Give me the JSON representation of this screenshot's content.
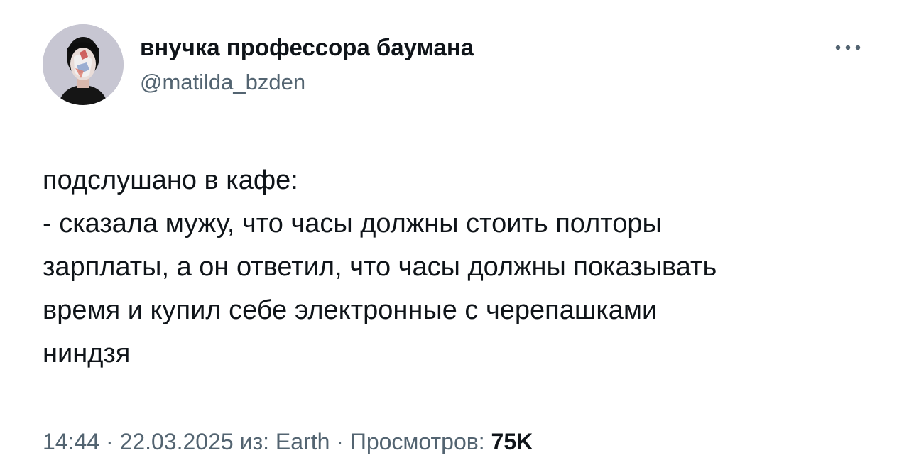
{
  "author": {
    "display_name": "внучка профессора баумана",
    "handle": "@matilda_bzden",
    "avatar": "avatar"
  },
  "more_icon": "more-horizontal-icon",
  "tweet": {
    "lines": [
      "подслушано в кафе:",
      "- сказала мужу, что часы должны стоить полторы",
      "зарплаты, а он ответил, что часы должны показывать",
      "время и купил себе электронные с черепашками",
      "ниндзя"
    ]
  },
  "meta": {
    "time": "14:44",
    "separator": " · ",
    "date": "22.03.2025",
    "source_label": "из:",
    "source": "Earth",
    "views_label": "Просмотров:",
    "views_count": "75K"
  },
  "colors": {
    "text_primary": "#0f1419",
    "text_secondary": "#536471",
    "background": "#ffffff"
  }
}
